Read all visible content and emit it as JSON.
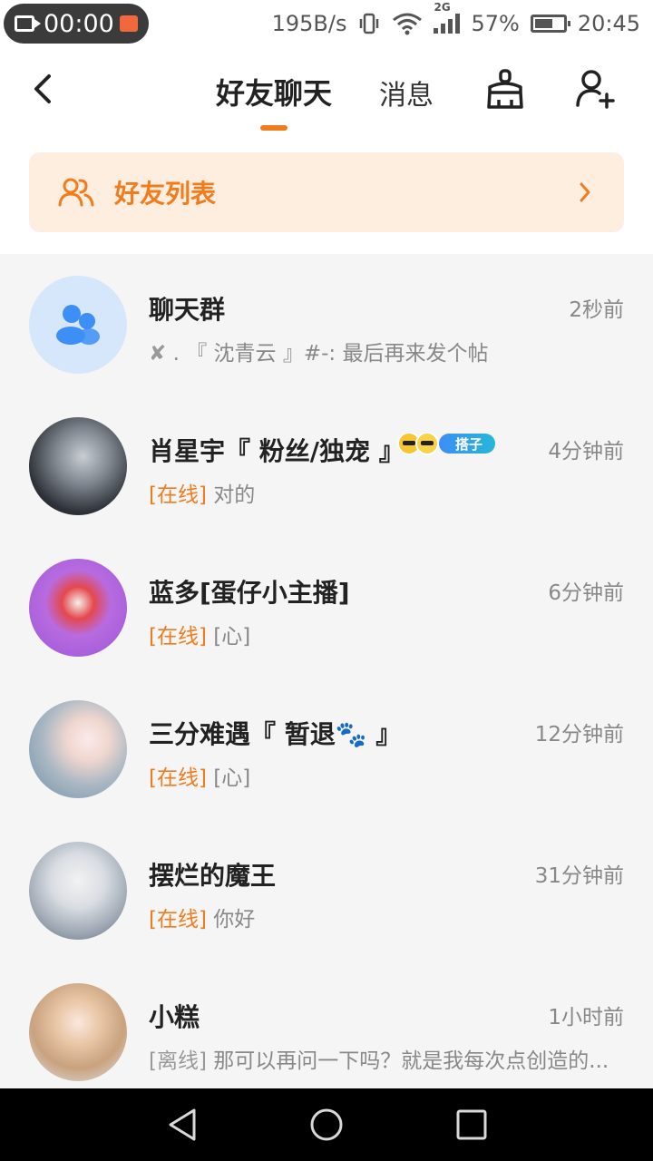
{
  "status_bar": {
    "recording_time": "00:00",
    "network_speed": "195B/s",
    "network_type": "2G",
    "battery": "57%",
    "time": "20:45"
  },
  "header": {
    "tab_active": "好友聊天",
    "tab_other": "消息",
    "icons": [
      "back-icon",
      "broom-icon",
      "add-user-icon"
    ]
  },
  "banner": {
    "label": "好友列表",
    "icon": "friends-icon"
  },
  "chats": [
    {
      "name": "聊天群",
      "time": "2秒前",
      "status": "",
      "preview_prefix": "✘",
      "preview": ". 『 沈青云 』#-: 最后再来发个帖",
      "avatar": "group-avatar"
    },
    {
      "name": "肖星宇『 粉丝/独宠 』",
      "time": "4分钟前",
      "status": "[在线]",
      "preview": "对的",
      "tag": "搭子",
      "avatar": "user-avatar"
    },
    {
      "name": "蓝多[蛋仔小主播]",
      "time": "6分钟前",
      "status": "[在线]",
      "preview": "[心]",
      "avatar": "user-avatar"
    },
    {
      "name": "三分难遇『 暂退🐾 』",
      "time": "12分钟前",
      "status": "[在线]",
      "preview": "[心]",
      "avatar": "user-avatar"
    },
    {
      "name": "摆烂的魔王",
      "time": "31分钟前",
      "status": "[在线]",
      "preview": "你好",
      "avatar": "user-avatar"
    },
    {
      "name": "小糕",
      "time": "1小时前",
      "status": "[离线]",
      "preview": "那可以再问一下吗？就是我每次点创造的...",
      "avatar": "user-avatar"
    }
  ],
  "colors": {
    "accent": "#f07c1e",
    "banner_bg": "#fdeee0",
    "list_bg": "#f5f5f5"
  }
}
